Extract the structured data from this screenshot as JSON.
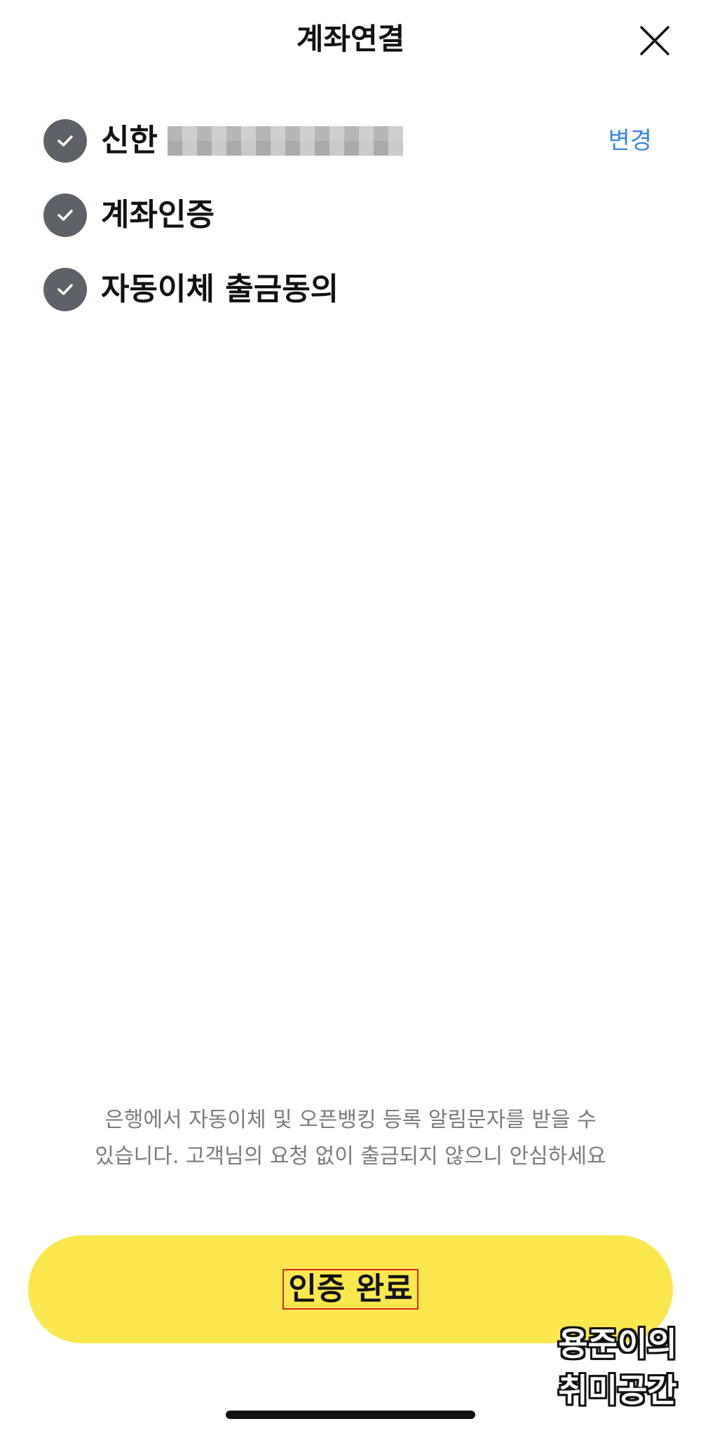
{
  "header": {
    "title": "계좌연결",
    "close_icon": "close-icon"
  },
  "steps": [
    {
      "label": "신한",
      "icon": "check-circle-icon",
      "masked": true,
      "action_label": "변경"
    },
    {
      "label": "계좌인증",
      "icon": "check-circle-icon"
    },
    {
      "label": "자동이체 출금동의",
      "icon": "check-circle-icon"
    }
  ],
  "notice": {
    "line1": "은행에서 자동이체 및 오픈뱅킹 등록 알림문자를 받을 수",
    "line2": "있습니다. 고객님의 요청 없이 출금되지 않으니 안심하세요"
  },
  "cta": {
    "label": "인증 완료",
    "color": "#fae84e"
  },
  "watermark": {
    "line1": "용준이의",
    "line2": "취미공간"
  },
  "colors": {
    "link": "#3a86e0",
    "check_bg": "#5f6169",
    "highlight_border": "#e3252d"
  }
}
